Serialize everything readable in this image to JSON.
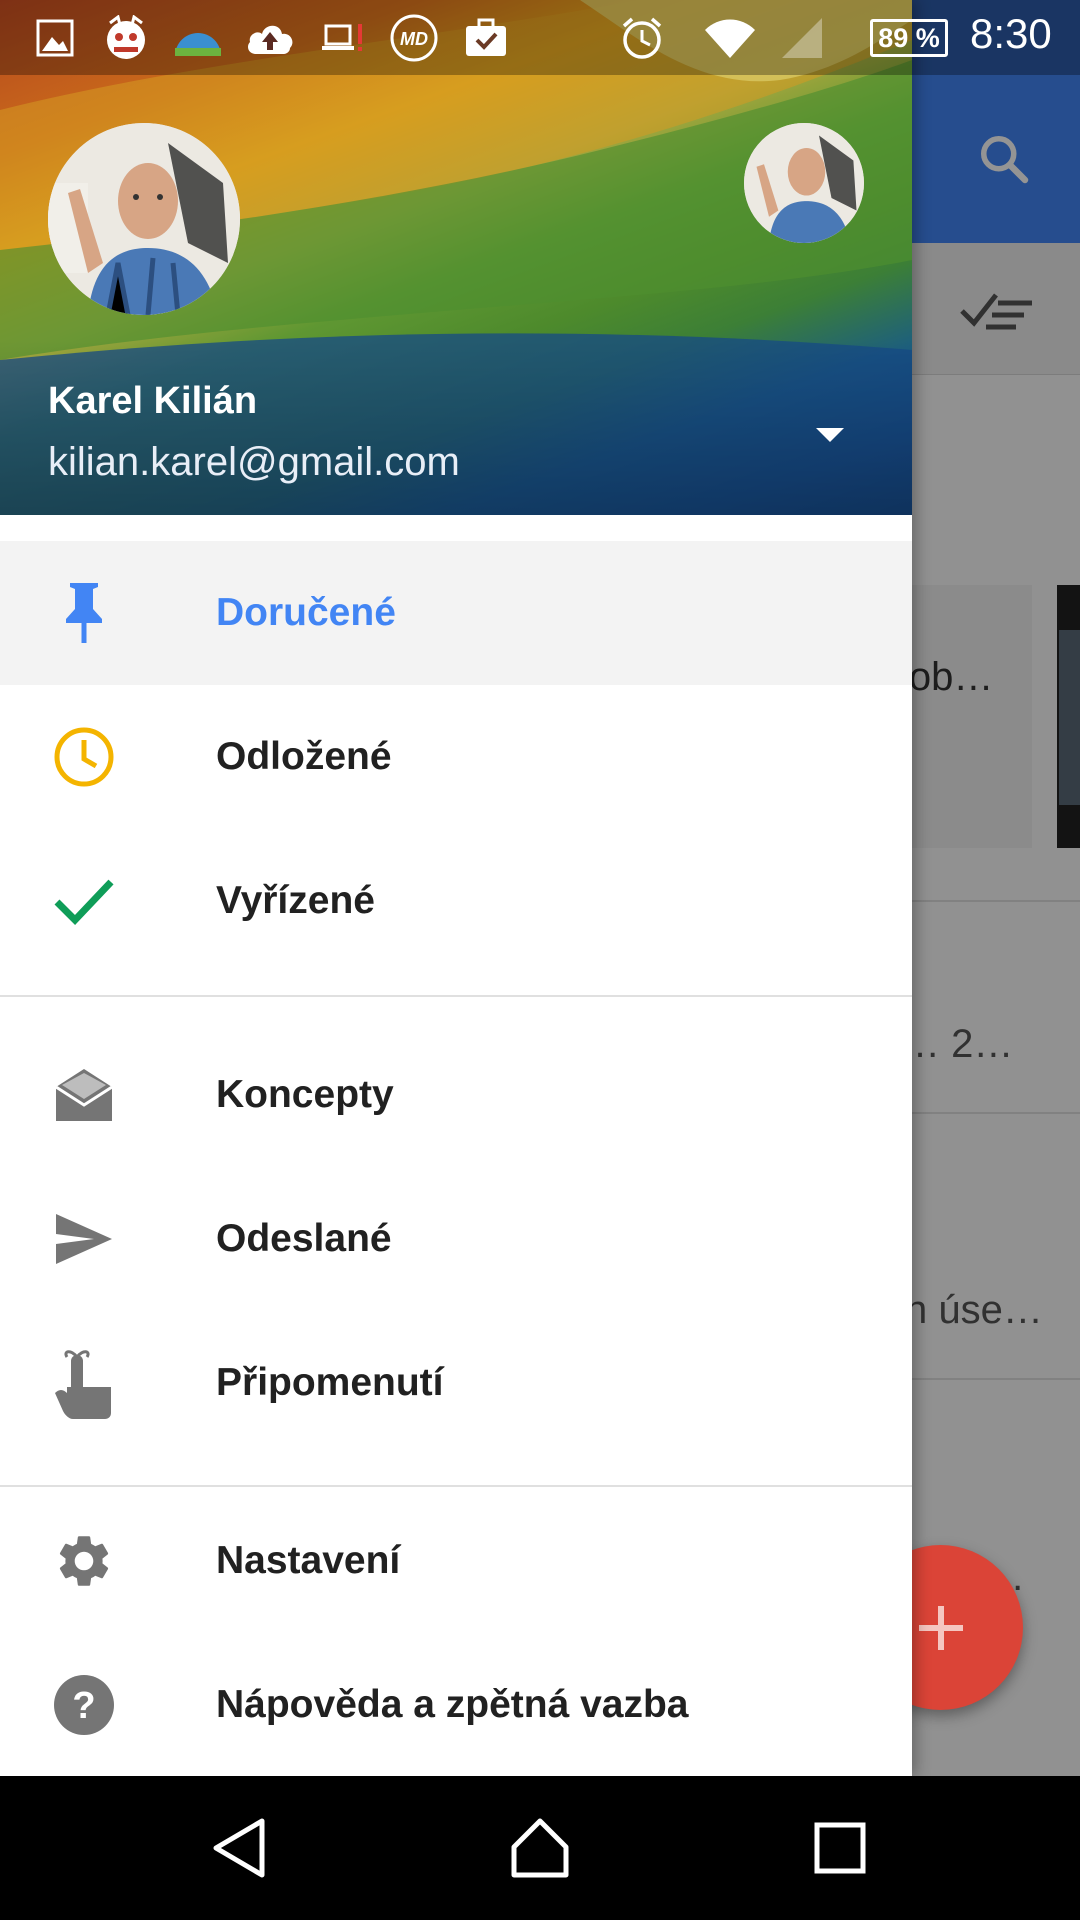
{
  "status_bar": {
    "battery": "89 %",
    "battery_level": 0.89,
    "time": "8:30",
    "icons": [
      "gallery-icon",
      "mascot-app-icon",
      "weather-icon",
      "cloud-upload-icon",
      "laptop-alert-icon",
      "md-app-icon",
      "briefcase-check-icon",
      "alarm-icon",
      "wifi-icon",
      "cell-signal-icon"
    ]
  },
  "background_app": {
    "snippet_1": "lob…",
    "snippet_2": "…  2…",
    "snippet_3": "n úse…",
    "snippet_4": "…",
    "compose_icon": "plus-icon"
  },
  "account": {
    "name": "Karel Kilián",
    "email": "kilian.karel@gmail.com"
  },
  "menu": {
    "items": [
      {
        "label": "Doručené",
        "icon": "pin-icon"
      },
      {
        "label": "Odložené",
        "icon": "clock-icon"
      },
      {
        "label": "Vyřízené",
        "icon": "check-icon"
      },
      {
        "label": "Koncepty",
        "icon": "drafts-icon"
      },
      {
        "label": "Odeslané",
        "icon": "send-icon"
      },
      {
        "label": "Připomenutí",
        "icon": "reminder-finger-icon"
      },
      {
        "label": "Nastavení",
        "icon": "gear-icon"
      },
      {
        "label": "Nápověda a zpětná vazba",
        "icon": "help-icon"
      }
    ]
  },
  "colors": {
    "accent": "#4285f4",
    "snooze": "#f4b400",
    "done": "#0f9d58",
    "fab": "#db4437"
  }
}
